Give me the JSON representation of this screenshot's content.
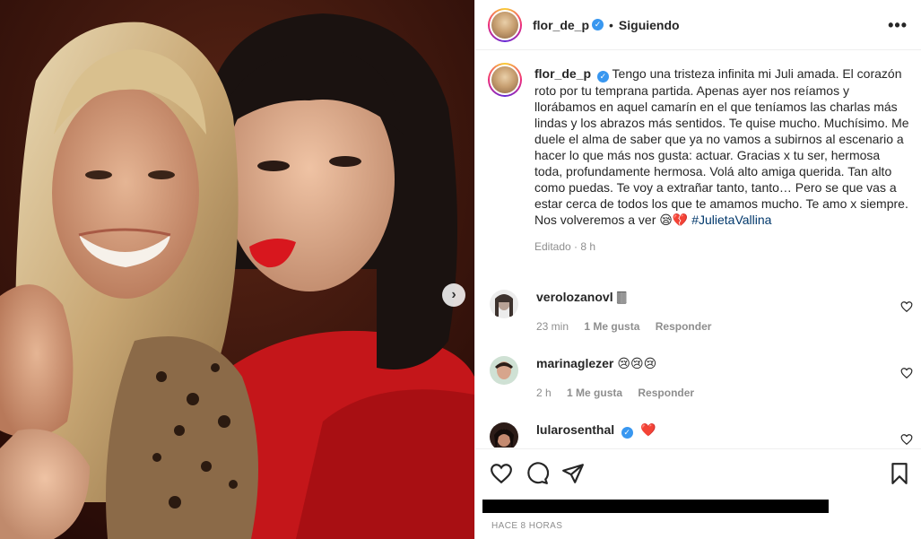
{
  "post": {
    "header": {
      "username": "flor_de_p",
      "separator": "•",
      "following_label": "Siguiendo",
      "more_icon": "more-horizontal-icon"
    },
    "caption": {
      "username": "flor_de_p",
      "text": "Tengo una tristeza infinita mi Juli amada. El corazón roto por tu temprana partida. Apenas ayer nos reíamos y llorábamos en aquel camarín en el que teníamos las charlas más lindas y los abrazos más sentidos. Te quise mucho. Muchísimo. Me duele el alma de saber que ya no vamos a subirnos al escenario a hacer lo que más nos gusta: actuar. Gracias x tu ser, hermosa toda, profundamente hermosa. Volá alto amiga querida. Tan alto como puedas. Te voy a extrañar tanto, tanto… Pero se que vas a estar cerca de todos los que te amamos mucho. Te amo x siempre. Nos volveremos a ver 😪💔",
      "hashtag": "#JulietaVallina",
      "edited_label": "Editado · 8 h"
    },
    "comments": [
      {
        "username": "verolozanovl",
        "text": "🀫",
        "time": "23 min",
        "likes": "1 Me gusta",
        "reply": "Responder"
      },
      {
        "username": "marinaglezer",
        "text": "😢😢😢",
        "time": "2 h",
        "likes": "1 Me gusta",
        "reply": "Responder"
      },
      {
        "username": "lularosenthal",
        "text": "❤️",
        "time": "",
        "likes": "",
        "reply": ""
      }
    ],
    "footer": {
      "timestamp": "HACE 8 HORAS",
      "icons": [
        "heart-icon",
        "comment-icon",
        "share-icon",
        "bookmark-icon"
      ]
    },
    "colors": {
      "verified": "#3897f0",
      "hashtag": "#00376b",
      "muted": "#8e8e8e"
    }
  }
}
